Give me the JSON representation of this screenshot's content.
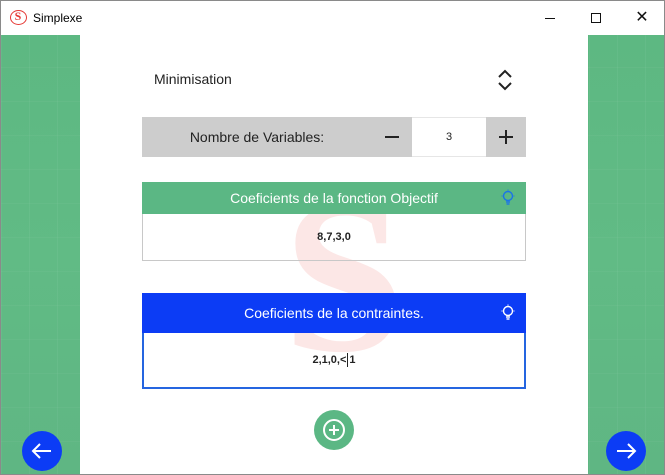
{
  "window": {
    "title": "Simplexe",
    "app_icon_letter": "S"
  },
  "colors": {
    "green": "#5bb784",
    "blue": "#0c3cf5",
    "stepper_gray": "#cdcdcd"
  },
  "mode_select": {
    "selected": "Minimisation",
    "icon": "chevron-up-down-icon"
  },
  "variables_stepper": {
    "label": "Nombre de Variables:",
    "value": "3",
    "decrement_icon": "minus-icon",
    "increment_icon": "plus-icon"
  },
  "objective_card": {
    "title": "Coeficients de la fonction Objectif",
    "value": "8,7,3,0",
    "icon": "lightbulb-icon"
  },
  "constraints_card": {
    "title": "Coeficients de la contraintes.",
    "value_before_caret": "2,1,0,<",
    "value_after_caret": "1",
    "icon": "lightbulb-icon"
  },
  "actions": {
    "add_icon": "plus-circle-icon",
    "prev_icon": "arrow-left-icon",
    "next_icon": "arrow-right-icon"
  }
}
